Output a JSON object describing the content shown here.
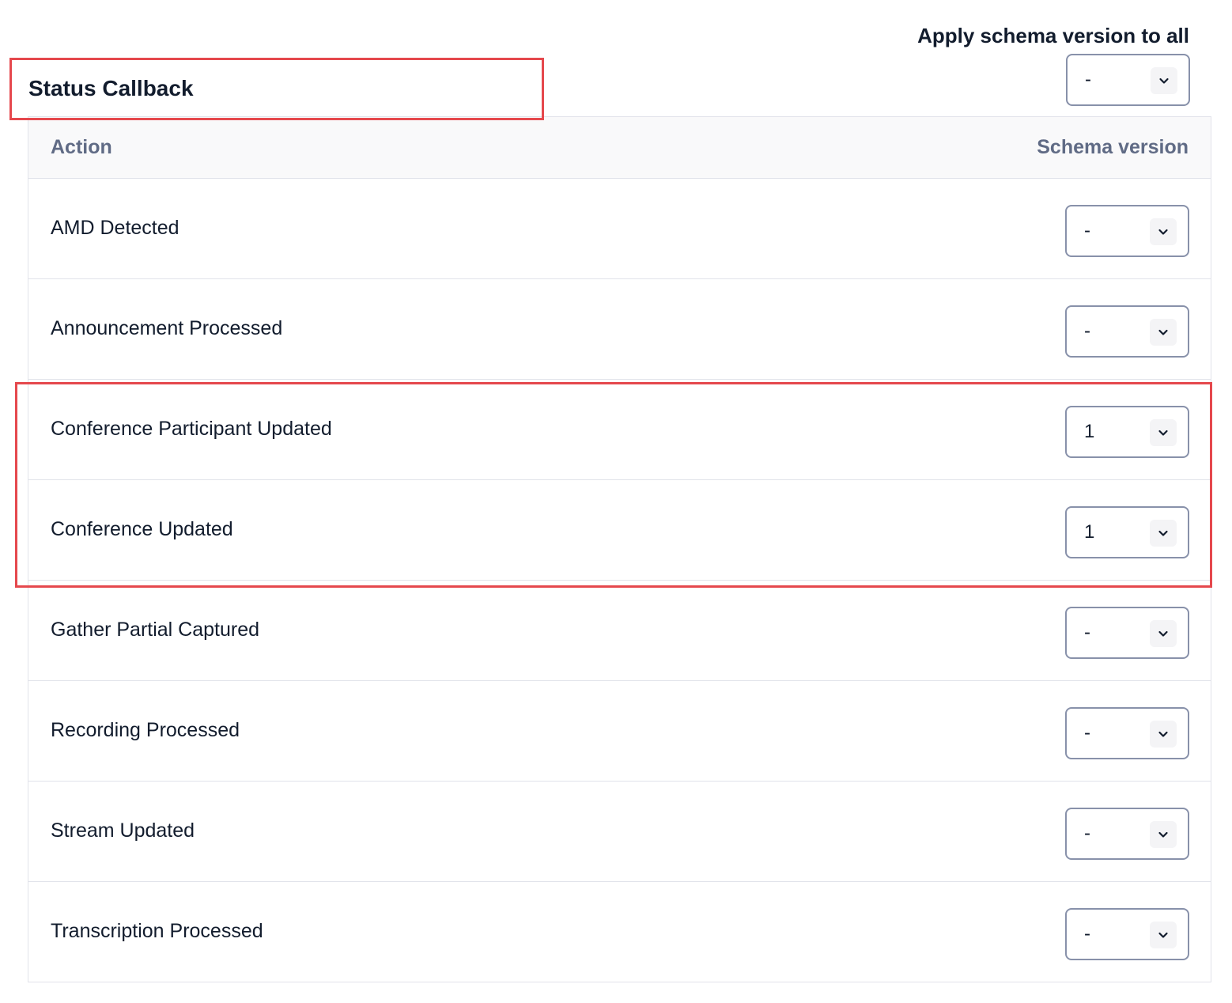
{
  "header": {
    "apply_label": "Apply schema version to all",
    "apply_value": "-"
  },
  "section": {
    "title": "Status Callback"
  },
  "table": {
    "columns": {
      "action": "Action",
      "schema_version": "Schema version"
    },
    "rows": [
      {
        "action": "AMD Detected",
        "version": "-"
      },
      {
        "action": "Announcement Processed",
        "version": "-"
      },
      {
        "action": "Conference Participant Updated",
        "version": "1"
      },
      {
        "action": "Conference Updated",
        "version": "1"
      },
      {
        "action": "Gather Partial Captured",
        "version": "-"
      },
      {
        "action": "Recording Processed",
        "version": "-"
      },
      {
        "action": "Stream Updated",
        "version": "-"
      },
      {
        "action": "Transcription Processed",
        "version": "-"
      }
    ]
  },
  "icons": {
    "dropdown": "chevron-down-icon"
  },
  "colors": {
    "highlight": "#e5484d",
    "text": "#121c2d",
    "header_text": "#606b85",
    "border": "#e1e3ea"
  }
}
